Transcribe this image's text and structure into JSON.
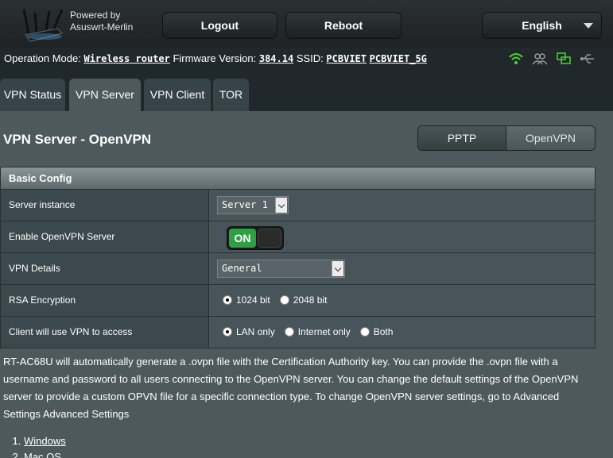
{
  "header": {
    "powered_line1": "Powered by",
    "powered_line2": "Asuswrt-Merlin",
    "logout_label": "Logout",
    "reboot_label": "Reboot",
    "language": "English"
  },
  "status": {
    "op_mode_label": "Operation Mode:",
    "op_mode_value": "Wireless router",
    "fw_label": "Firmware Version:",
    "fw_value": "384.14",
    "ssid_label": "SSID:",
    "ssid_1": "PCBVIET",
    "ssid_2": "PCBVIET_5G",
    "icons": [
      "wifi-icon",
      "clients-icon",
      "network-icon",
      "usb-icon"
    ],
    "accent_green": "#4cd137"
  },
  "tabs": [
    {
      "label": "VPN Status",
      "active": false
    },
    {
      "label": "VPN Server",
      "active": true
    },
    {
      "label": "VPN Client",
      "active": false
    },
    {
      "label": "TOR",
      "active": false
    }
  ],
  "page": {
    "title": "VPN Server - OpenVPN",
    "switch_pptp": "PPTP",
    "switch_openvpn": "OpenVPN"
  },
  "config": {
    "section_title": "Basic Config",
    "rows": {
      "server_instance": {
        "label": "Server instance",
        "value": "Server 1"
      },
      "enable": {
        "label": "Enable OpenVPN Server",
        "value": "ON"
      },
      "details": {
        "label": "VPN Details",
        "value": "General"
      },
      "rsa": {
        "label": "RSA Encryption",
        "opt1": "1024 bit",
        "opt2": "2048 bit",
        "selected": "1024 bit"
      },
      "access": {
        "label": "Client will use VPN to access",
        "opt1": "LAN only",
        "opt2": "Internet only",
        "opt3": "Both",
        "selected": "LAN only"
      }
    }
  },
  "description": "RT-AC68U will automatically generate a .ovpn file with the Certification Authority key. You can provide the .ovpn file with a username and password to all users connecting to the OpenVPN server. You can change the default settings of the OpenVPN server to provide a custom OPVN file for a specific connection type. To change OpenVPN server settings, go to Advanced Settings Advanced Settings",
  "links": [
    "Windows",
    "Mac OS"
  ]
}
